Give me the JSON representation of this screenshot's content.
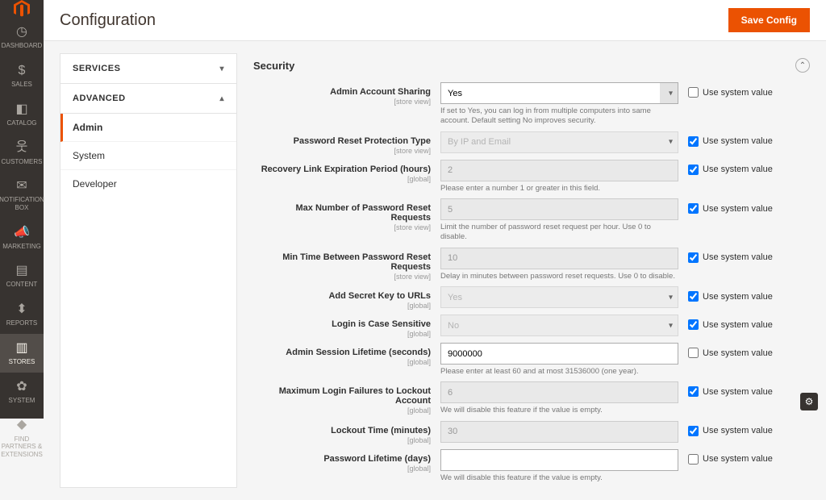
{
  "page": {
    "title": "Configuration",
    "save_label": "Save Config"
  },
  "sidebar_nav": [
    {
      "label": "DASHBOARD",
      "icon": "◷"
    },
    {
      "label": "SALES",
      "icon": "$"
    },
    {
      "label": "CATALOG",
      "icon": "◧"
    },
    {
      "label": "CUSTOMERS",
      "icon": "웃"
    },
    {
      "label": "NOTIFICATION BOX",
      "icon": "✉"
    },
    {
      "label": "MARKETING",
      "icon": "📣"
    },
    {
      "label": "CONTENT",
      "icon": "▤"
    },
    {
      "label": "REPORTS",
      "icon": "⬍"
    },
    {
      "label": "STORES",
      "icon": "▥",
      "active": true
    },
    {
      "label": "SYSTEM",
      "icon": "✿"
    },
    {
      "label": "FIND PARTNERS & EXTENSIONS",
      "icon": "◆"
    }
  ],
  "config_nav": {
    "sections": [
      {
        "label": "SERVICES",
        "expanded": false
      },
      {
        "label": "ADVANCED",
        "expanded": true,
        "items": [
          {
            "label": "Admin",
            "active": true
          },
          {
            "label": "System"
          },
          {
            "label": "Developer"
          }
        ]
      }
    ]
  },
  "fieldset": {
    "title": "Security"
  },
  "use_system_label": "Use system value",
  "fields": {
    "account_sharing": {
      "label": "Admin Account Sharing",
      "scope": "[store view]",
      "value": "Yes",
      "note": "If set to Yes, you can log in from multiple computers into same account. Default setting No improves security.",
      "use_system": false,
      "disabled": false
    },
    "pwd_reset_type": {
      "label": "Password Reset Protection Type",
      "scope": "[store view]",
      "value": "By IP and Email",
      "use_system": true,
      "disabled": true
    },
    "recovery_link": {
      "label": "Recovery Link Expiration Period (hours)",
      "scope": "[global]",
      "value": "2",
      "note": "Please enter a number 1 or greater in this field.",
      "use_system": true,
      "disabled": true
    },
    "max_reset": {
      "label": "Max Number of Password Reset Requests",
      "scope": "[store view]",
      "value": "5",
      "note": "Limit the number of password reset request per hour. Use 0 to disable.",
      "use_system": true,
      "disabled": true
    },
    "min_time": {
      "label": "Min Time Between Password Reset Requests",
      "scope": "[store view]",
      "value": "10",
      "note": "Delay in minutes between password reset requests. Use 0 to disable.",
      "use_system": true,
      "disabled": true
    },
    "secret_key": {
      "label": "Add Secret Key to URLs",
      "scope": "[global]",
      "value": "Yes",
      "use_system": true,
      "disabled": true
    },
    "case_sensitive": {
      "label": "Login is Case Sensitive",
      "scope": "[global]",
      "value": "No",
      "use_system": true,
      "disabled": true
    },
    "session_lifetime": {
      "label": "Admin Session Lifetime (seconds)",
      "scope": "[global]",
      "value": "9000000",
      "note": "Please enter at least 60 and at most 31536000 (one year).",
      "use_system": false,
      "disabled": false
    },
    "max_failures": {
      "label": "Maximum Login Failures to Lockout Account",
      "scope": "[global]",
      "value": "6",
      "note": "We will disable this feature if the value is empty.",
      "use_system": true,
      "disabled": true
    },
    "lockout_time": {
      "label": "Lockout Time (minutes)",
      "scope": "[global]",
      "value": "30",
      "use_system": true,
      "disabled": true
    },
    "pwd_lifetime": {
      "label": "Password Lifetime (days)",
      "scope": "[global]",
      "value": "",
      "note": "We will disable this feature if the value is empty.",
      "use_system": false,
      "disabled": false
    }
  }
}
